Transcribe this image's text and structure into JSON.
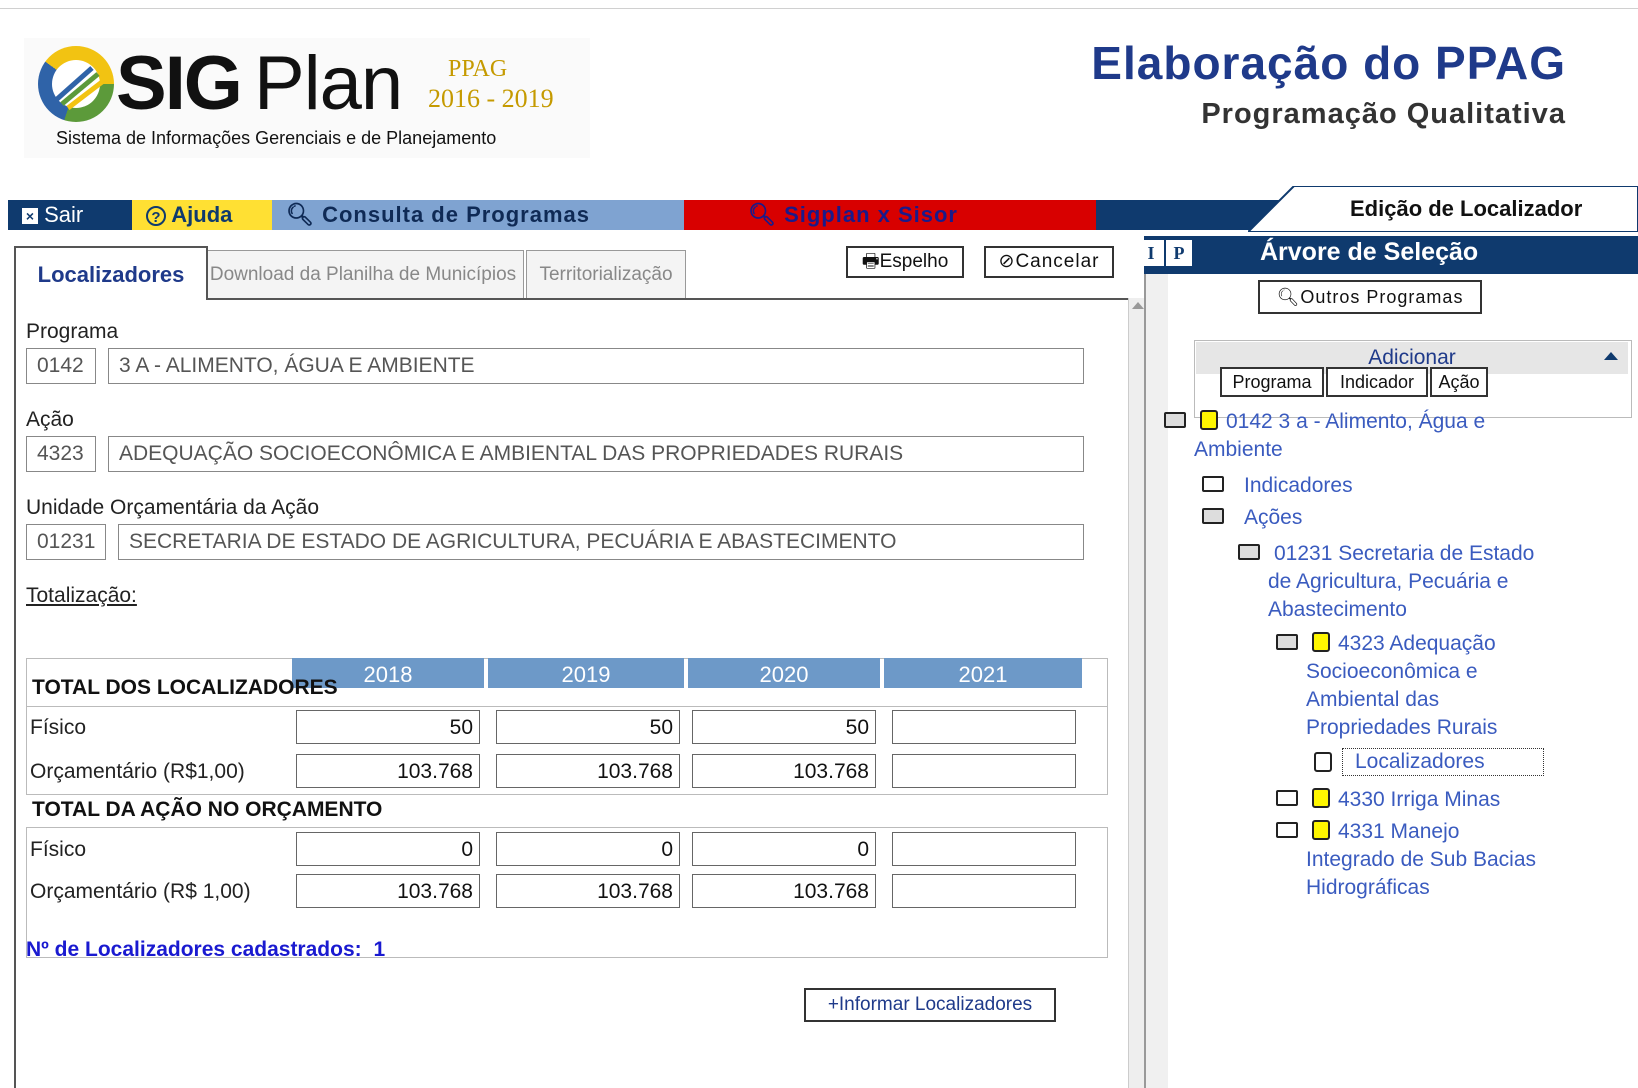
{
  "logo": {
    "sig": "SIG",
    "plan": "Plan",
    "ppag": "PPAG",
    "years": "2016 - 2019",
    "subtitle": "Sistema de Informações Gerenciais e de Planejamento"
  },
  "header": {
    "title": "Elaboração do PPAG",
    "subtitle": "Programação Qualitativa"
  },
  "menu": {
    "sair": "Sair",
    "ajuda": "Ajuda",
    "consulta": "Consulta de Programas",
    "sigplan": "Sigplan x Sisor",
    "edicao": "Edição de Localizador"
  },
  "tabs": [
    {
      "label": "Localizadores"
    },
    {
      "label": "Download da Planilha de Municípios"
    },
    {
      "label": "Territorialização"
    }
  ],
  "buttons": {
    "espelho": "Espelho",
    "cancelar": "Cancelar",
    "informar": "+Informar Localizadores"
  },
  "form": {
    "programa_label": "Programa",
    "programa_code": "0142",
    "programa_name": "3 A - ALIMENTO, ÁGUA E AMBIENTE",
    "acao_label": "Ação",
    "acao_code": "4323",
    "acao_name": "ADEQUAÇÃO SOCIOECONÔMICA E AMBIENTAL DAS PROPRIEDADES RURAIS",
    "unidade_label": "Unidade Orçamentária da Ação",
    "unidade_code": "01231",
    "unidade_name": "SECRETARIA DE ESTADO DE AGRICULTURA, PECUÁRIA E ABASTECIMENTO",
    "totalizacao": "Totalização:"
  },
  "table": {
    "years": [
      "2018",
      "2019",
      "2020",
      "2021"
    ],
    "section1": "TOTAL DOS LOCALIZADORES",
    "section2": "TOTAL DA AÇÃO NO ORÇAMENTO",
    "rows": [
      {
        "label": "Físico",
        "values": [
          "50",
          "50",
          "50",
          ""
        ]
      },
      {
        "label": "Orçamentário (R$1,00)",
        "values": [
          "103.768",
          "103.768",
          "103.768",
          ""
        ]
      },
      {
        "label": "Físico",
        "values": [
          "0",
          "0",
          "0",
          ""
        ]
      },
      {
        "label": "Orçamentário (R$ 1,00)",
        "values": [
          "103.768",
          "103.768",
          "103.768",
          ""
        ]
      }
    ]
  },
  "count": {
    "label": "Nº de Localizadores cadastrados:",
    "value": "1"
  },
  "tree_panel": {
    "ip_i": "I",
    "ip_p": "P",
    "title": "Árvore de Seleção",
    "outros": "Outros Programas",
    "adicionar": "Adicionar",
    "add_buttons": [
      "Programa",
      "Indicador",
      "Ação"
    ],
    "nodes": {
      "programa": "0142 3 a - Alimento, Água e",
      "programa_cont": "Ambiente",
      "indicadores": "Indicadores",
      "acoes": "Ações",
      "unidade": "01231 Secretaria de Estado",
      "unidade_2": "de Agricultura, Pecuária e",
      "unidade_3": "Abastecimento",
      "acao1": "4323 Adequação",
      "acao1_2": "Socioeconômica e",
      "acao1_3": "Ambiental das",
      "acao1_4": "Propriedades Rurais",
      "localizadores": "Localizadores",
      "acao2": "4330 Irriga Minas",
      "acao3": "4331 Manejo",
      "acao3_2": "Integrado de Sub Bacias",
      "acao3_3": "Hidrográficas"
    }
  }
}
